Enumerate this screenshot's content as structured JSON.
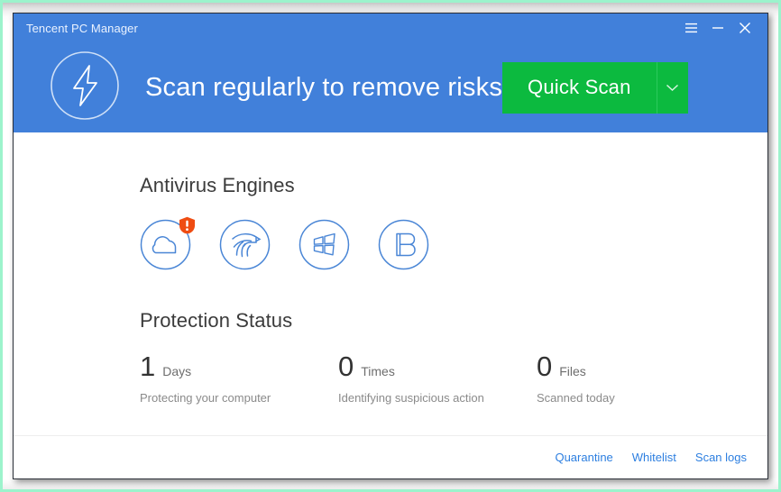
{
  "window": {
    "title": "Tencent PC Manager",
    "controls": [
      {
        "name": "menu-button",
        "icon": "hamburger-menu-icon",
        "label": "Menu"
      },
      {
        "name": "minimize-button",
        "icon": "minimize-icon",
        "label": "Minimize"
      },
      {
        "name": "close-button",
        "icon": "close-icon",
        "label": "Close"
      }
    ]
  },
  "banner": {
    "icon": "lightning-bolt-shield-icon",
    "headline": "Scan regularly to remove risks",
    "accent_color": "#4180da",
    "quick_scan": {
      "label": "Quick Scan",
      "color": "#0cba3f",
      "dropdown_icon": "chevron-down-icon"
    }
  },
  "antivirus": {
    "title": "Antivirus Engines",
    "engines": [
      {
        "name": "cloud-engine",
        "icon": "cloud-icon",
        "badge": "alert-badge",
        "badge_color": "#ef4c12"
      },
      {
        "name": "eagle-engine",
        "icon": "eagle-icon",
        "badge": null
      },
      {
        "name": "windows-defender-engine",
        "icon": "windows-logo-icon",
        "badge": null
      },
      {
        "name": "bitdefender-engine",
        "icon": "letter-b-icon",
        "badge": null
      }
    ]
  },
  "protection": {
    "title": "Protection Status",
    "stats": [
      {
        "value": "1",
        "unit": "Days",
        "caption": "Protecting your computer"
      },
      {
        "value": "0",
        "unit": "Times",
        "caption": "Identifying suspicious action"
      },
      {
        "value": "0",
        "unit": "Files",
        "caption": "Scanned today"
      }
    ]
  },
  "footer": {
    "links": [
      {
        "label": "Quarantine"
      },
      {
        "label": "Whitelist"
      },
      {
        "label": "Scan logs"
      }
    ]
  }
}
